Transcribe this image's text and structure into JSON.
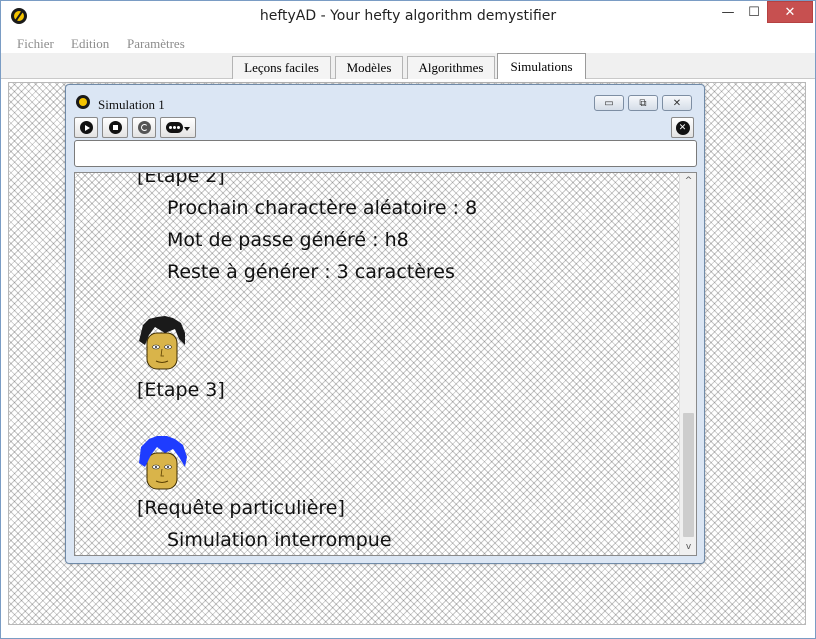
{
  "app": {
    "title": "heftyAD - Your hefty algorithm demystifier",
    "window_controls": {
      "minimize": "—",
      "maximize": "☐",
      "close": "✕"
    }
  },
  "menu": [
    "Fichier",
    "Edition",
    "Paramètres"
  ],
  "tabs": [
    {
      "label": "Leçons faciles",
      "active": false
    },
    {
      "label": "Modèles",
      "active": false
    },
    {
      "label": "Algorithmes",
      "active": false
    },
    {
      "label": "Simulations",
      "active": true
    }
  ],
  "simulation_window": {
    "title": "Simulation 1",
    "controls": {
      "minimize": "▭",
      "maximize": "⧉",
      "close": "✕"
    },
    "toolbar": {
      "play": "play-icon",
      "stop": "stop-icon",
      "reset": "reset-icon",
      "more": "more-options-icon",
      "close": "close-circle-icon"
    },
    "input_value": "",
    "log": {
      "step2_header": "[Etape 2]",
      "step2_lines": [
        "Prochain charactère aléatoire : 8",
        "Mot de passe généré : h8",
        "Reste à générer : 3 caractères"
      ],
      "step3_header": "[Etape 3]",
      "request_header": "[Requête particulière]",
      "request_line": "Simulation interrompue",
      "avatar_colors": {
        "black_hair": "#1a1a1a",
        "blue_hair": "#1e3cff",
        "skin": "#d9b44a"
      }
    }
  }
}
